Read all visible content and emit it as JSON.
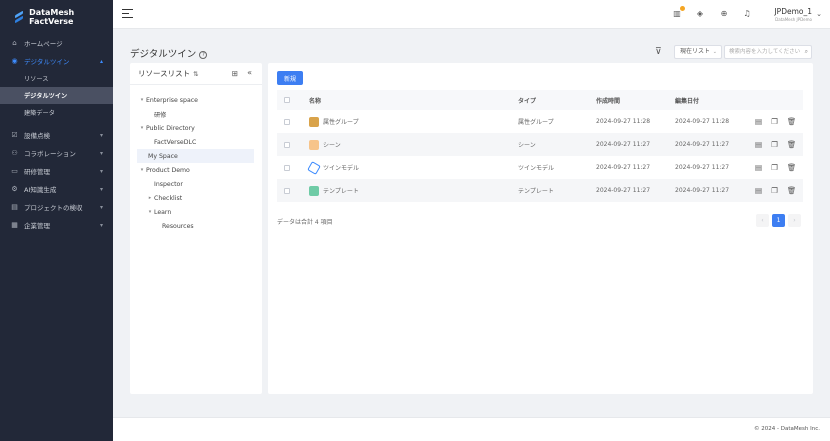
{
  "brand": {
    "name": "DataMesh FactVerse"
  },
  "sidebar": {
    "items": [
      {
        "label": "ホームページ",
        "icon": "home-icon"
      },
      {
        "label": "デジタルツイン",
        "icon": "twin-icon",
        "active": true
      },
      {
        "label": "設備点検",
        "icon": "inspection-icon"
      },
      {
        "label": "コラボレーション",
        "icon": "collaboration-icon"
      },
      {
        "label": "研修管理",
        "icon": "training-icon"
      },
      {
        "label": "AI知識生成",
        "icon": "ai-icon"
      },
      {
        "label": "プロジェクトの検収",
        "icon": "project-icon"
      },
      {
        "label": "企業管理",
        "icon": "enterprise-icon"
      }
    ],
    "sub_items": [
      {
        "label": "リソース"
      },
      {
        "label": "デジタルツイン",
        "selected": true
      },
      {
        "label": "建築データ"
      }
    ]
  },
  "header": {
    "user_name": "JPDemo_1",
    "user_sub": "DataMesh JPDemo"
  },
  "page": {
    "title": "デジタルツイン",
    "scope_label": "現在リスト",
    "search_placeholder": "検索内容を入力してください"
  },
  "resource_panel": {
    "title": "リソースリスト",
    "tree": [
      {
        "label": "Enterprise space",
        "depth": 0,
        "toggle": "▾"
      },
      {
        "label": "研修",
        "depth": 1,
        "toggle": ""
      },
      {
        "label": "Public Directory",
        "depth": 0,
        "toggle": "▾"
      },
      {
        "label": "FactVerseDLC",
        "depth": 1,
        "toggle": ""
      },
      {
        "label": "My Space",
        "depth": 0,
        "toggle": "",
        "selected": true
      },
      {
        "label": "Product Demo",
        "depth": 0,
        "toggle": "▾"
      },
      {
        "label": "Inspector",
        "depth": 1,
        "toggle": ""
      },
      {
        "label": "Checklist",
        "depth": 1,
        "toggle": "▸"
      },
      {
        "label": "Learn",
        "depth": 1,
        "toggle": "▾"
      },
      {
        "label": "Resources",
        "depth": 2,
        "toggle": ""
      }
    ]
  },
  "table": {
    "new_button": "新規",
    "columns": {
      "name": "名称",
      "type": "タイプ",
      "created": "作成時間",
      "edited": "編集日付"
    },
    "rows": [
      {
        "name": "属性グループ",
        "type": "属性グループ",
        "created": "2024-09-27 11:28",
        "edited": "2024-09-27 11:28",
        "icon": "group"
      },
      {
        "name": "シーン",
        "type": "シーン",
        "created": "2024-09-27 11:27",
        "edited": "2024-09-27 11:27",
        "icon": "scene"
      },
      {
        "name": "ツインモデル",
        "type": "ツインモデル",
        "created": "2024-09-27 11:27",
        "edited": "2024-09-27 11:27",
        "icon": "twin"
      },
      {
        "name": "テンプレート",
        "type": "テンプレート",
        "created": "2024-09-27 11:27",
        "edited": "2024-09-27 11:27",
        "icon": "template"
      }
    ],
    "summary": "データは合計 4 項目",
    "current_page": "1"
  },
  "footer": {
    "text": "© 2024 - DataMesh Inc."
  }
}
